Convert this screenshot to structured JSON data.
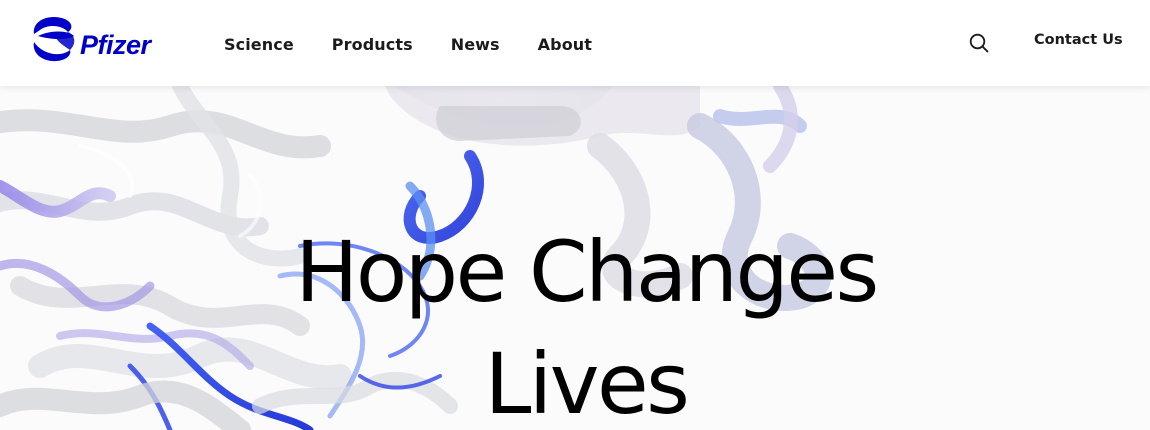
{
  "brand": {
    "name": "Pfizer",
    "logo_color": "#0000c9"
  },
  "nav": {
    "items": [
      {
        "label": "Science"
      },
      {
        "label": "Products"
      },
      {
        "label": "News"
      },
      {
        "label": "About"
      }
    ]
  },
  "header": {
    "search_icon": "search-icon",
    "contact_label": "Contact Us"
  },
  "hero": {
    "headline_line1": "Hope Changes",
    "headline_line2": "Lives",
    "background": "protein-ribbon-illustration",
    "accent_colors": [
      "#2b3fe0",
      "#4a8cf0",
      "#7b6fe0",
      "#d9dadd"
    ]
  }
}
